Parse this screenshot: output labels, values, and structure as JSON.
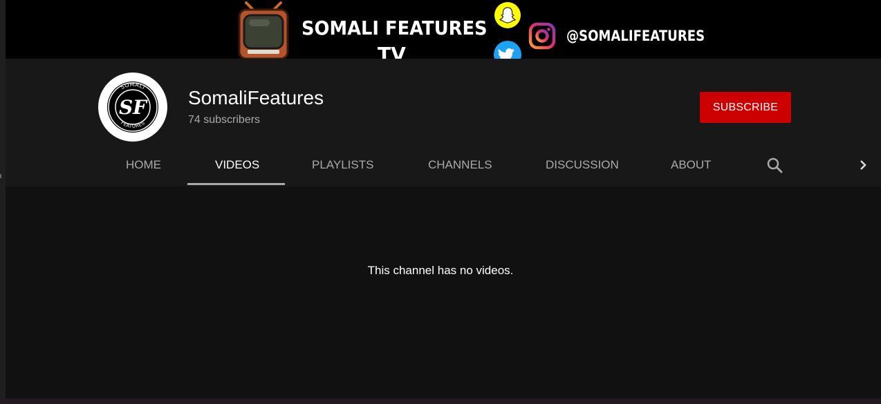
{
  "banner": {
    "title_line1": "SOMALI FEATURES",
    "title_line2": "TV",
    "instagram_handle": "@SOMALIFEATURES",
    "icons": [
      "tv-icon",
      "snapchat-icon",
      "twitter-icon",
      "instagram-icon"
    ],
    "colors": {
      "snapchat": "#fffc00",
      "twitter": "#1da1f2"
    }
  },
  "channel": {
    "name": "SomaliFeatures",
    "subscribers": "74 subscribers",
    "avatar_text": "SF",
    "avatar_ring_top": "SOMALI",
    "avatar_ring_bottom": "FEATURES",
    "subscribe_label": "SUBSCRIBE",
    "subscribe_color": "#cc0000"
  },
  "tabs": [
    {
      "label": "HOME",
      "active": false
    },
    {
      "label": "VIDEOS",
      "active": true
    },
    {
      "label": "PLAYLISTS",
      "active": false
    },
    {
      "label": "CHANNELS",
      "active": false
    },
    {
      "label": "DISCUSSION",
      "active": false
    },
    {
      "label": "ABOUT",
      "active": false
    }
  ],
  "tab_icons": [
    "search-icon",
    "chevron-right-icon"
  ],
  "content": {
    "empty_message": "This channel has no videos."
  }
}
